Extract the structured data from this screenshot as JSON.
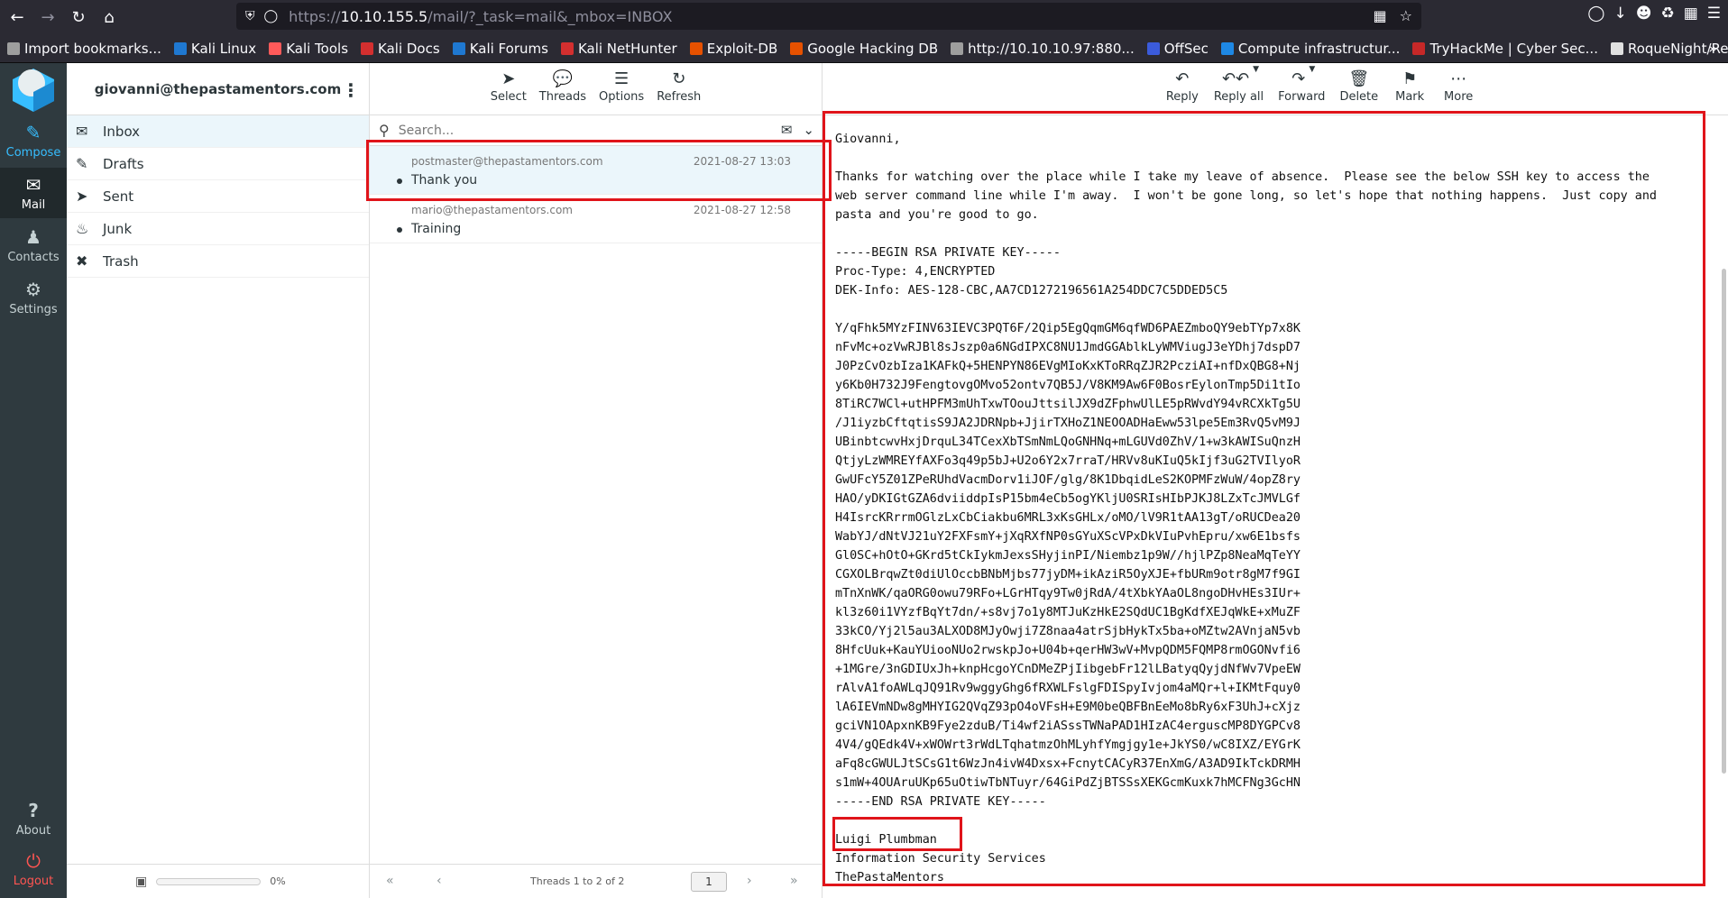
{
  "browser": {
    "url_prefix": "https://",
    "url_host": "10.10.155.5",
    "url_path": "/mail/?_task=mail&_mbox=INBOX",
    "bookmarks": [
      {
        "label": "Import bookmarks...",
        "color": "#9e9e9e"
      },
      {
        "label": "Kali Linux",
        "color": "#1f78d1"
      },
      {
        "label": "Kali Tools",
        "color": "#ff5a5a"
      },
      {
        "label": "Kali Docs",
        "color": "#d32f2f"
      },
      {
        "label": "Kali Forums",
        "color": "#1f78d1"
      },
      {
        "label": "Kali NetHunter",
        "color": "#d32f2f"
      },
      {
        "label": "Exploit-DB",
        "color": "#e65100"
      },
      {
        "label": "Google Hacking DB",
        "color": "#e65100"
      },
      {
        "label": "http://10.10.10.97:880...",
        "color": "#9e9e9e"
      },
      {
        "label": "OffSec",
        "color": "#3b5bdb"
      },
      {
        "label": "Compute infrastructur...",
        "color": "#1e88e5"
      },
      {
        "label": "TryHackMe | Cyber Sec...",
        "color": "#c62828"
      },
      {
        "label": "RoqueNight/Reverse-...",
        "color": "#e0e0e0"
      }
    ]
  },
  "rail": {
    "compose": "Compose",
    "mail": "Mail",
    "contacts": "Contacts",
    "settings": "Settings",
    "about": "About",
    "logout": "Logout"
  },
  "account": "giovanni@thepastamentors.com",
  "folders": [
    {
      "label": "Inbox",
      "icon": "inbox-icon"
    },
    {
      "label": "Drafts",
      "icon": "pencil-icon"
    },
    {
      "label": "Sent",
      "icon": "paper-plane-icon"
    },
    {
      "label": "Junk",
      "icon": "fire-icon"
    },
    {
      "label": "Trash",
      "icon": "trash-icon"
    }
  ],
  "quota": {
    "label": "0%",
    "percent": 0
  },
  "list_toolbar": {
    "select": "Select",
    "threads": "Threads",
    "options": "Options",
    "refresh": "Refresh"
  },
  "search": {
    "placeholder": "Search..."
  },
  "messages": [
    {
      "from": "postmaster@thepastamentors.com",
      "date": "2021-08-27 13:03",
      "subject": "Thank you"
    },
    {
      "from": "mario@thepastamentors.com",
      "date": "2021-08-27 12:58",
      "subject": "Training"
    }
  ],
  "pager": {
    "count": "Threads 1 to 2 of 2",
    "page": "1"
  },
  "preview_toolbar": {
    "reply": "Reply",
    "reply_all": "Reply all",
    "forward": "Forward",
    "delete": "Delete",
    "mark": "Mark",
    "more": "More"
  },
  "body": {
    "text": "Giovanni,\n\nThanks for watching over the place while I take my leave of absence.  Please see the below SSH key to access the\nweb server command line while I'm away.  I won't be gone long, so let's hope that nothing happens.  Just copy and\npasta and you're good to go.\n\n-----BEGIN RSA PRIVATE KEY-----\nProc-Type: 4,ENCRYPTED\nDEK-Info: AES-128-CBC,AA7CD1272196561A254DDC7C5DDED5C5\n\nY/qFhk5MYzFINV63IEVC3PQT6F/2Qip5EgQqmGM6qfWD6PAEZmboQY9ebTYp7x8K\nnFvMc+ozVwRJBl8sJszp0a6NGdIPXC8NU1JmdGGAblkLyWMViugJ3eYDhj7dspD7\nJ0PzCvOzbIza1KAFkQ+5HENPYN86EVgMIoKxKToRRqZJR2PcziAI+nfDxQBG8+Nj\ny6Kb0H732J9FengtovgOMvo52ontv7QB5J/V8KM9Aw6F0BosrEylonTmp5Di1tIo\n8TiRC7WCl+utHPFM3mUhTxwTOouJttsilJX9dZFphwUlLE5pRWvdY94vRCXkTg5U\n/J1iyzbCftqtisS9JA2JDRNpb+JjirTXHoZ1NEOOADHaEww53lpe5Em3RvQ5vM9J\nUBinbtcwvHxjDrquL34TCexXbTSmNmLQoGNHNq+mLGUVd0ZhV/1+w3kAWISuQnzH\nQtjyLzWMREYfAXFo3q49p5bJ+U2o6Y2x7rraT/HRVv8uKIuQ5kIjf3uG2TVIlyoR\nGwUFcY5Z01ZPeRUhdVacmDorv1iJOF/glg/8K1DbqidLeS2KOPMFzWuW/4opZ8ry\nHAO/yDKIGtGZA6dviiddpIsP15bm4eCb5ogYKljU0SRIsHIbPJKJ8LZxTcJMVLGf\nH4IsrcKRrrmOGlzLxCbCiakbu6MRL3xKsGHLx/oMO/lV9R1tAA13gT/oRUCDea20\nWabYJ/dNtVJ21uY2FXFsmY+jXqRXfNP0sGYuXScVPxDkVIuPvhEpru/xw6E1bsfs\nGl0SC+hOtO+GKrd5tCkIykmJexsSHyjinPI/Niembz1p9W//hjlPZp8NeaMqTeYY\nCGXOLBrqwZt0diUlOccbBNbMjbs77jyDM+ikAziR5OyXJE+fbURm9otr8gM7f9GI\nmTnXnWK/qaORG0owu79RFo+LGrHTqy9Tw0jRdA/4tXbkYAaOL8ngoDHvHEs3IUr+\nkl3z60i1VYzfBqYt7dn/+s8vj7o1y8MTJuKzHkE2SQdUC1BgKdfXEJqWkE+xMuZF\n33kCO/Yj2l5au3ALXOD8MJyOwji7Z8naa4atrSjbHykTx5ba+oMZtw2AVnjaN5vb\n8HfcUuk+KauYUiooNUo2rwskpJo+U04b+qerHW3wV+MvpQDM5FQMP8rmOGONvfi6\n+1MGre/3nGDIUxJh+knpHcgoYCnDMeZPjIibgebFr12lLBatyqQyjdNfWv7VpeEW\nrAlvA1foAWLqJQ91Rv9wggyGhg6fRXWLFslgFDISpyIvjom4aMQr+l+IKMtFquy0\nlA6IEVmNDw8gMHYIG2QVqZ93pO4oVFsH+E9M0beQBFBnEeMo8bRy6xF3UhJ+cXjz\ngciVN1OApxnKB9Fye2zduB/Ti4wf2iASssTWNaPAD1HIzAC4erguscMP8DYGPCv8\n4V4/gQEdk4V+xWOWrt3rWdLTqhatmzOhMLyhfYmgjgy1e+JkYS0/wC8IXZ/EYGrK\naFq8cGWULJtSCsG1t6WzJn4ivW4Dxsx+FcnytCACyR37EnXmG/A3AD9IkTckDRMH\ns1mW+4OUAruUKp65uOtiwTbNTuyr/64GiPdZjBTSSsXEKGcmKuxk7hMCFNg3GcHN\n-----END RSA PRIVATE KEY-----\n\nLuigi Plumbman\nInformation Security Services\nThePastaMentors"
  },
  "colors": {
    "accent": "#37beff",
    "highlight": "#e0141a",
    "rail_bg": "#2f3a3f",
    "logout": "#ff5552"
  }
}
